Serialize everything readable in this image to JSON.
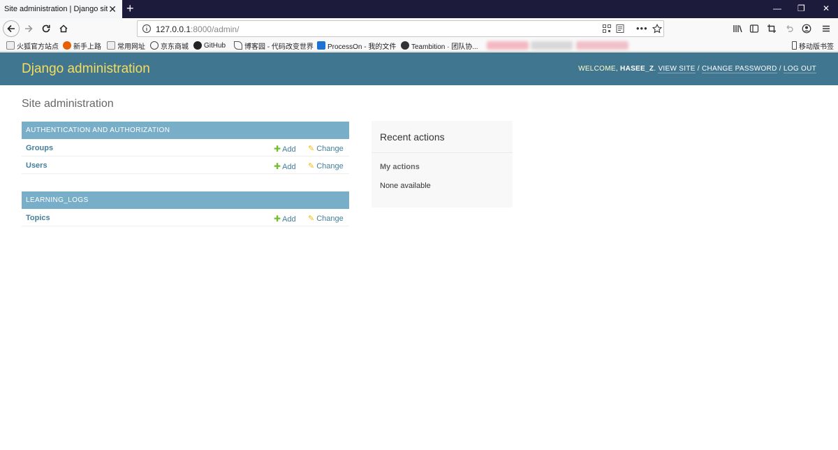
{
  "browser": {
    "tab_title": "Site administration | Django site admin",
    "url_host": "127.0.0.1",
    "url_rest": ":8000/admin/",
    "window_controls": {
      "minimize": "—",
      "restore": "❐",
      "close": "✕"
    },
    "bookmarks": [
      {
        "label": "火狐官方站点",
        "icon": "folder-icon"
      },
      {
        "label": "新手上路",
        "icon": "firefox-icon"
      },
      {
        "label": "常用网址",
        "icon": "folder-icon"
      },
      {
        "label": "京东商城",
        "icon": "globe-icon"
      },
      {
        "label": "GitHub",
        "icon": "github-icon"
      },
      {
        "label": "博客园 - 代码改变世界",
        "icon": "cnblogs-icon"
      },
      {
        "label": "ProcessOn - 我的文件",
        "icon": "processon-icon"
      },
      {
        "label": "Teambition · 团队协...",
        "icon": "teambition-icon"
      }
    ],
    "mobile_bookmarks": "移动版书签"
  },
  "admin": {
    "branding": "Django administration",
    "welcome": "WELCOME,",
    "username": "HASEE_Z",
    "view_site": "VIEW SITE",
    "change_password": "CHANGE PASSWORD",
    "log_out": "LOG OUT",
    "page_title": "Site administration",
    "modules": [
      {
        "caption": "AUTHENTICATION AND AUTHORIZATION",
        "models": [
          {
            "name": "Groups"
          },
          {
            "name": "Users"
          }
        ]
      },
      {
        "caption": "LEARNING_LOGS",
        "models": [
          {
            "name": "Topics"
          }
        ]
      }
    ],
    "add_label": "Add",
    "change_label": "Change",
    "recent": {
      "title": "Recent actions",
      "subtitle": "My actions",
      "empty": "None available"
    }
  },
  "colors": {
    "header_bg": "#417690",
    "brand": "#f5dd5d",
    "caption_bg": "#79aec8",
    "link": "#447e9b",
    "add_icon": "#70bf2b",
    "change_icon": "#efb80b"
  }
}
